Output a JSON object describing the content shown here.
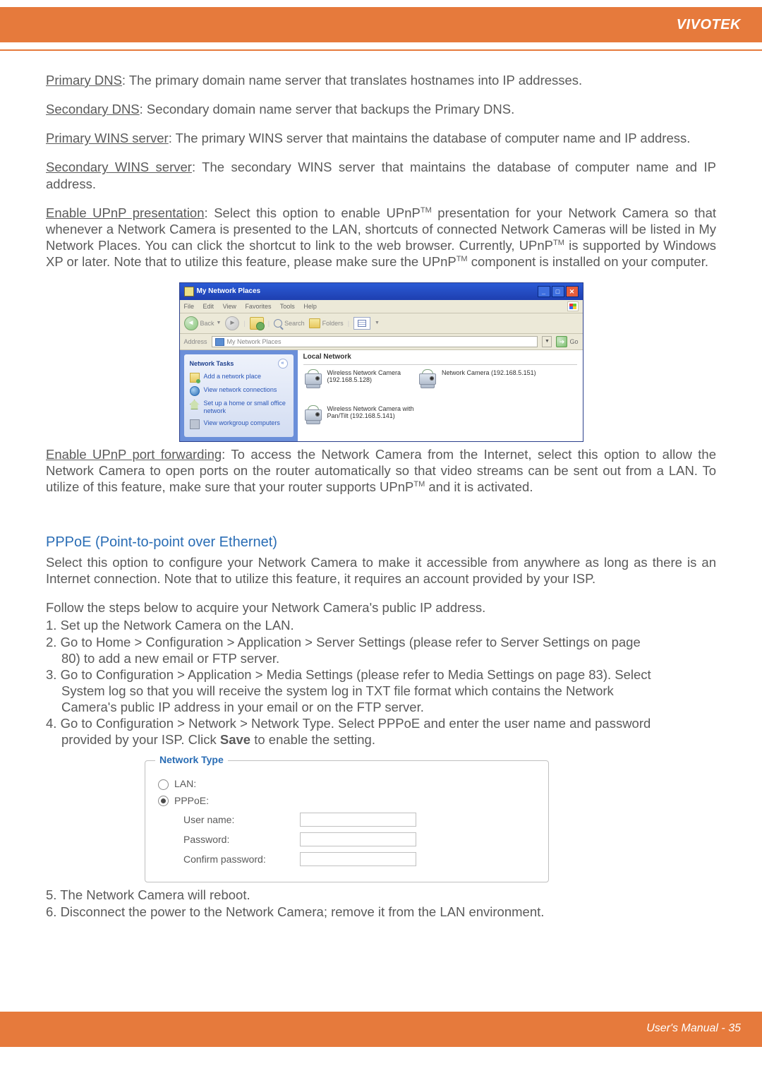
{
  "header": {
    "brand": "VIVOTEK"
  },
  "body": {
    "primary_dns_label": "Primary DNS",
    "primary_dns_text": ": The primary domain name server that translates hostnames into IP addresses.",
    "secondary_dns_label": "Secondary DNS",
    "secondary_dns_text": ": Secondary domain name server that backups the Primary DNS.",
    "primary_wins_label": "Primary WINS server",
    "primary_wins_text": ": The primary WINS server that maintains the database of computer name and IP address.",
    "secondary_wins_label": "Secondary WINS server",
    "secondary_wins_text": ": The secondary WINS server that maintains the database of computer name and IP address.",
    "upnp_pres_label": "Enable UPnP presentation",
    "upnp_pres_text_a": ": Select this option to enable UPnP",
    "upnp_pres_text_b": " presentation for your Network Camera so that whenever a Network Camera is presented to the LAN, shortcuts of connected Network Cameras will be listed in My Network Places. You can click the shortcut to link to the web browser. Currently, UPnP",
    "upnp_pres_text_c": " is supported by Windows XP or later. Note that to utilize this feature, please make sure the UPnP",
    "upnp_pres_text_d": " component is installed on your computer.",
    "tm": "TM",
    "upnp_fwd_label": "Enable UPnP port forwarding",
    "upnp_fwd_text_a": ": To access the Network Camera from the Internet, select this option to allow the Network Camera to open ports on the router automatically so that video streams can be sent out from a LAN. To utilize of this feature, make sure that your router supports UPnP",
    "upnp_fwd_text_b": " and it is activated."
  },
  "xp": {
    "title": "My Network Places",
    "menu": {
      "file": "File",
      "edit": "Edit",
      "view": "View",
      "favorites": "Favorites",
      "tools": "Tools",
      "help": "Help"
    },
    "toolbar": {
      "back": "Back",
      "search": "Search",
      "folders": "Folders"
    },
    "address_label": "Address",
    "address_value": "My Network Places",
    "go": "Go",
    "side": {
      "title": "Network Tasks",
      "add": "Add a network place",
      "view_conn": "View network connections",
      "setup": "Set up a home or small office network",
      "workgroup": "View workgroup computers"
    },
    "main": {
      "section": "Local Network",
      "dev1_l1": "Wireless Network Camera",
      "dev1_l2": "(192.168.5.128)",
      "dev2": "Network Camera (192.168.5.151)",
      "dev3_l1": "Wireless Network Camera with",
      "dev3_l2": "Pan/Tilt (192.168.5.141)"
    }
  },
  "pppoe": {
    "title": "PPPoE (Point-to-point over Ethernet)",
    "intro": "Select this option to configure your Network Camera to make it accessible from anywhere as long as there is an Internet connection. Note that to utilize this feature, it requires an account provided by your ISP.",
    "follow": "Follow the steps below to acquire your Network Camera's public IP address.",
    "s1": "1. Set up the Network Camera on the LAN.",
    "s2a": "2. Go to Home > Configuration > Application > Server Settings (please refer to Server Settings on page",
    "s2b": "80) to add a new email or FTP server.",
    "s3a": "3. Go to Configuration > Application > Media Settings (please refer to Media Settings on page 83). Select",
    "s3b": "System log so that you will receive the system log in TXT file format which contains the Network",
    "s3c": "Camera's public IP address in your email or on the FTP server.",
    "s4a": "4. Go to Configuration > Network > Network Type. Select PPPoE and enter the user name and password",
    "s4b_a": "provided by your ISP. Click ",
    "s4b_bold": "Save",
    "s4b_b": " to enable the setting.",
    "s5": "5. The Network Camera will reboot.",
    "s6": "6. Disconnect the power to the Network Camera; remove it from the LAN environment."
  },
  "form": {
    "legend": "Network Type",
    "lan": "LAN:",
    "pppoe": "PPPoE:",
    "user": "User name:",
    "pass": "Password:",
    "confirm": "Confirm password:"
  },
  "footer": {
    "page": "User's Manual - 35"
  }
}
